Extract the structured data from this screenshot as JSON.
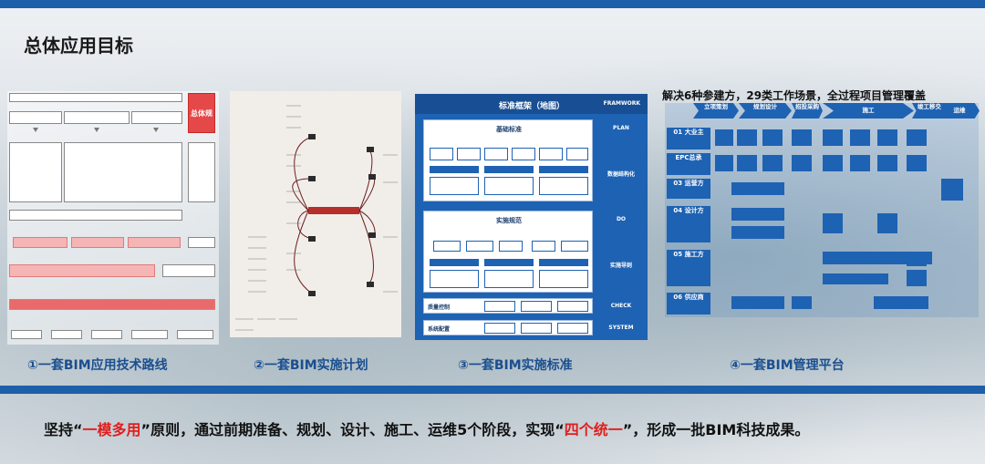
{
  "title": "总体应用目标",
  "captions": [
    "①一套BIM应用技术路线",
    "②一套BIM实施计划",
    "③一套BIM实施标准",
    "④一套BIM管理平台"
  ],
  "footer": {
    "part1": "坚持“",
    "highlight1": "一模多用",
    "part2": "”原则，通过前期准备、规划、设计、施工、运维5个阶段，实现“",
    "highlight2": "四个统一",
    "part3": "”，形成一批BIM科技成果。"
  },
  "colors": {
    "stripe": "#1d5fa8",
    "highlight": "#e01f1f",
    "panel_blue": "#1e62b3"
  },
  "panel1": {
    "red_label": "总体规划"
  },
  "panel3": {
    "header_title": "标准框架（地图）",
    "header_tag": "FRAMWORK",
    "sections": [
      {
        "title": "基础标准",
        "tag": "PLAN",
        "side": "数据结构化"
      },
      {
        "title": "实施规范",
        "tag": "DO",
        "side": "实施导则"
      },
      {
        "title": "质量控制",
        "tag": "CHECK"
      },
      {
        "title": "系统配置",
        "tag": "SYSTEM"
      }
    ]
  },
  "panel4": {
    "title": "解决6种参建方，29类工作场景，全过程项目管理覆盖",
    "phases": [
      "立项策划",
      "规划设计",
      "招投采购",
      "施工",
      "竣工移交",
      "运维"
    ],
    "rows": [
      "01 大业主",
      "EPC总承",
      "03 运营方",
      "04 设计方",
      "05 施工方",
      "06 供应商"
    ]
  }
}
